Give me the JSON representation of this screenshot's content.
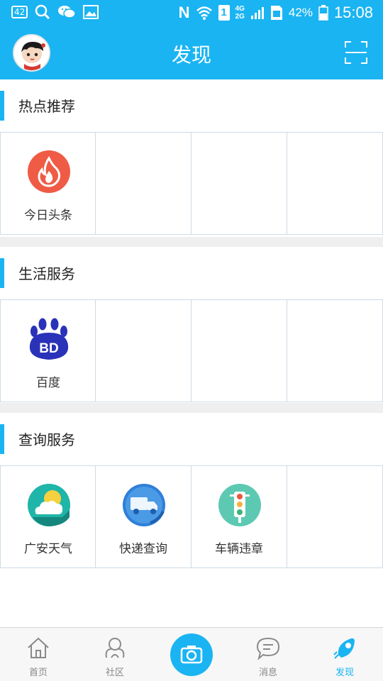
{
  "status_bar": {
    "notification_count": "42",
    "network": "4G 2G",
    "battery": "42%",
    "time": "15:08",
    "sim": "1"
  },
  "header": {
    "title": "发现",
    "scan_icon": "scan-icon",
    "avatar": "avatar"
  },
  "sections": [
    {
      "title": "热点推荐",
      "items": [
        {
          "label": "今日头条",
          "icon": "flame-icon",
          "color": "#ef5b45"
        }
      ]
    },
    {
      "title": "生活服务",
      "items": [
        {
          "label": "百度",
          "icon": "baidu-paw-icon",
          "color": "#2932b8"
        }
      ]
    },
    {
      "title": "查询服务",
      "items": [
        {
          "label": "广安天气",
          "icon": "weather-icon",
          "color": "#1fb5a8"
        },
        {
          "label": "快递查询",
          "icon": "delivery-truck-icon",
          "color": "#3a87dd"
        },
        {
          "label": "车辆违章",
          "icon": "traffic-light-icon",
          "color": "#5ec9b2"
        }
      ]
    }
  ],
  "bottom_nav": {
    "items": [
      {
        "label": "首页",
        "icon": "home-icon"
      },
      {
        "label": "社区",
        "icon": "community-icon"
      },
      {
        "label": "",
        "icon": "camera-icon"
      },
      {
        "label": "消息",
        "icon": "message-icon"
      },
      {
        "label": "发现",
        "icon": "rocket-icon",
        "active": true
      }
    ]
  },
  "colors": {
    "accent": "#1ab4f2",
    "divider": "#cfdbe4",
    "separator": "#efefef"
  }
}
